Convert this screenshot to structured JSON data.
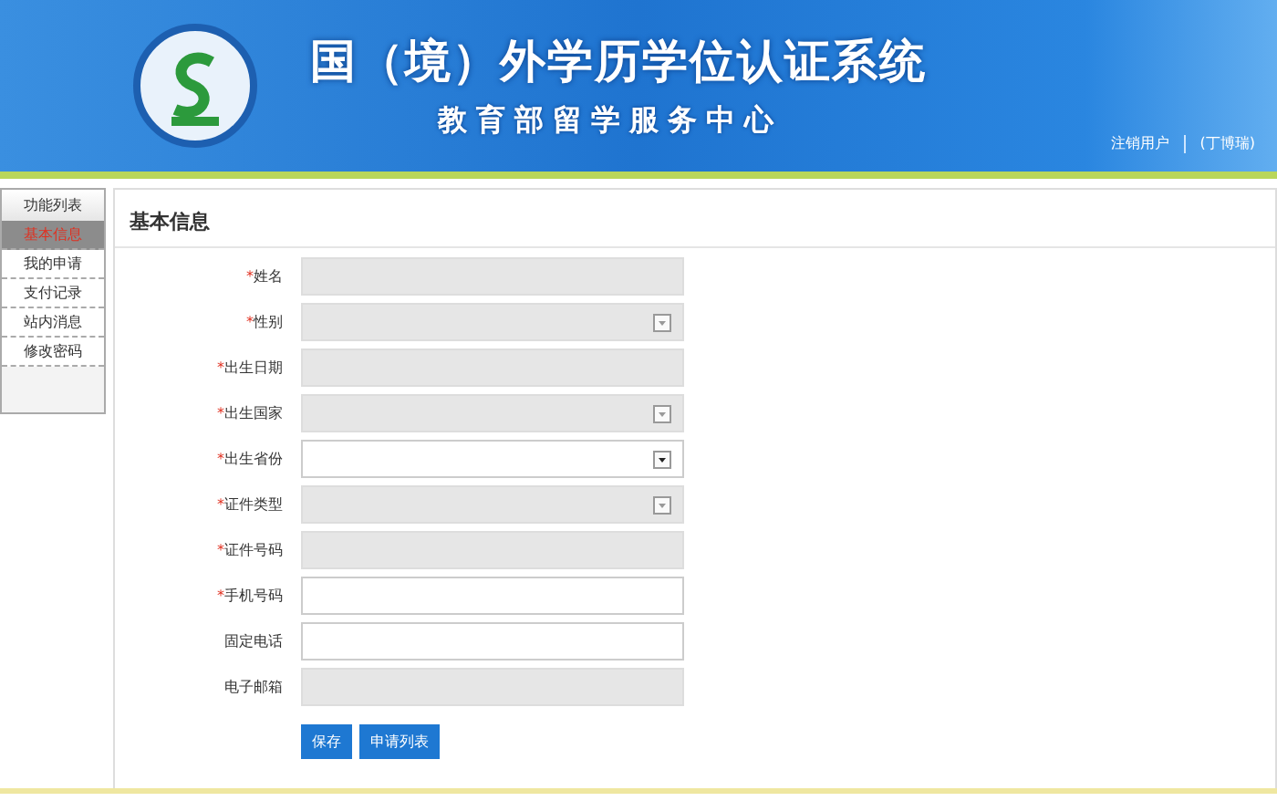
{
  "header": {
    "title": "国（境）外学历学位认证系统",
    "subtitle": "教育部留学服务中心",
    "logout": "注销用户",
    "user": "(丁博瑞)"
  },
  "sidebar": {
    "heading": "功能列表",
    "items": [
      {
        "label": "基本信息",
        "selected": true
      },
      {
        "label": "我的申请",
        "selected": false
      },
      {
        "label": "支付记录",
        "selected": false
      },
      {
        "label": "站内消息",
        "selected": false
      },
      {
        "label": "修改密码",
        "selected": false
      }
    ]
  },
  "form": {
    "title": "基本信息",
    "fields": [
      {
        "required_mark": "*",
        "label": "姓名",
        "kind": "input",
        "disabled": true
      },
      {
        "required_mark": "*",
        "label": "性别",
        "kind": "select",
        "disabled": true
      },
      {
        "required_mark": "*",
        "label": "出生日期",
        "kind": "input",
        "disabled": true
      },
      {
        "required_mark": "*",
        "label": "出生国家",
        "kind": "select",
        "disabled": true
      },
      {
        "required_mark": "*",
        "label": "出生省份",
        "kind": "select",
        "disabled": false
      },
      {
        "required_mark": "*",
        "label": "证件类型",
        "kind": "select",
        "disabled": true
      },
      {
        "required_mark": "*",
        "label": "证件号码",
        "kind": "input",
        "disabled": true
      },
      {
        "required_mark": "*",
        "label": "手机号码",
        "kind": "input",
        "disabled": false
      },
      {
        "label": "固定电话",
        "kind": "input",
        "disabled": false
      },
      {
        "label": "电子邮箱",
        "kind": "input",
        "disabled": true
      }
    ],
    "buttons": [
      "保存",
      "申请列表"
    ]
  }
}
